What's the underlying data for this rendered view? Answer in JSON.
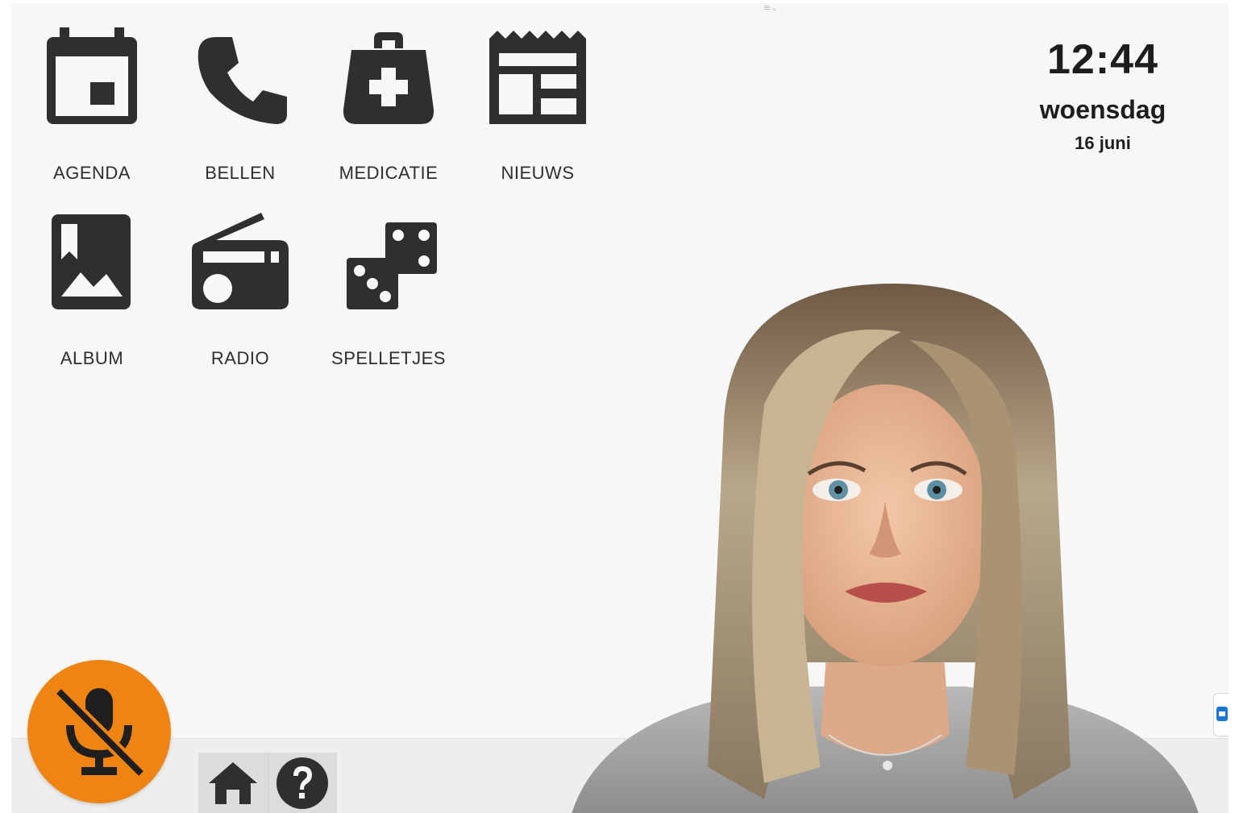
{
  "apps": [
    {
      "label": "AGENDA",
      "icon": "calendar-icon"
    },
    {
      "label": "BELLEN",
      "icon": "phone-icon"
    },
    {
      "label": "MEDICATIE",
      "icon": "medical-kit-icon"
    },
    {
      "label": "NIEUWS",
      "icon": "newspaper-icon"
    },
    {
      "label": "ALBUM",
      "icon": "photo-album-icon"
    },
    {
      "label": "RADIO",
      "icon": "radio-icon"
    },
    {
      "label": "SPELLETJES",
      "icon": "dice-icon"
    }
  ],
  "clock": {
    "time": "12:44",
    "day": "woensdag",
    "date": "16 juni"
  },
  "controls": {
    "microphone": {
      "state": "muted",
      "icon": "microphone-off-icon",
      "color": "#f08413"
    },
    "home": {
      "icon": "home-icon"
    },
    "help": {
      "icon": "help-icon"
    }
  },
  "colors": {
    "background": "#f7f7f7",
    "icon": "#2f2f2f",
    "accent": "#f08413"
  }
}
